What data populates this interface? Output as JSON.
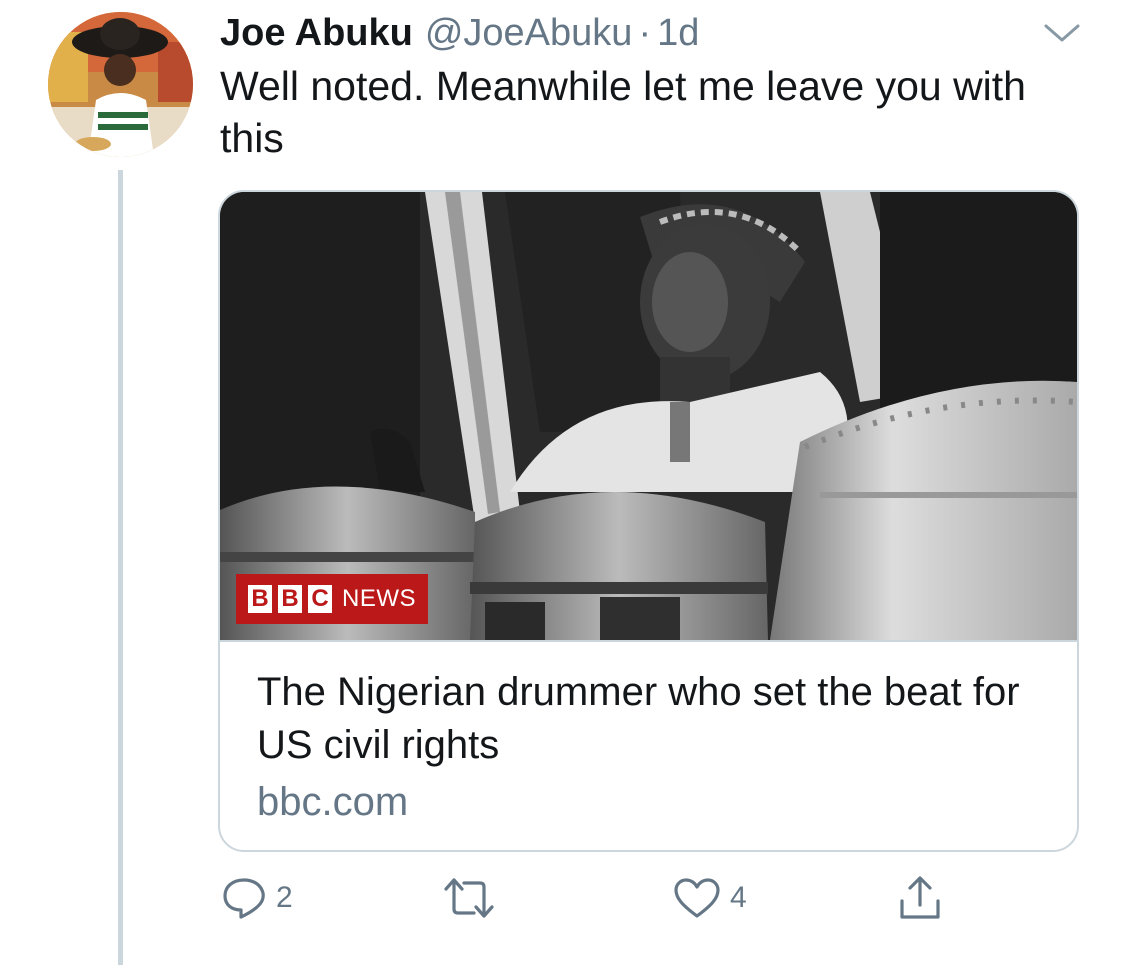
{
  "tweet": {
    "author_name": "Joe Abuku",
    "handle": "@JoeAbuku",
    "separator": "·",
    "time": "1d",
    "text": "Well noted. Meanwhile let me leave you with this"
  },
  "card": {
    "logo": {
      "letters": [
        "B",
        "B",
        "C"
      ],
      "word": "NEWS"
    },
    "title": "The Nigerian drummer who set the beat for US civil rights",
    "domain": "bbc.com"
  },
  "actions": {
    "reply_count": "2",
    "retweet_count": "",
    "like_count": "4"
  },
  "icons": {
    "caret": "chevron-down-icon",
    "reply": "reply-icon",
    "retweet": "retweet-icon",
    "like": "heart-icon",
    "share": "share-icon"
  },
  "colors": {
    "text": "#14171a",
    "secondary": "#657786",
    "border": "#ccd6dd",
    "bbc_red": "#bb1919"
  }
}
